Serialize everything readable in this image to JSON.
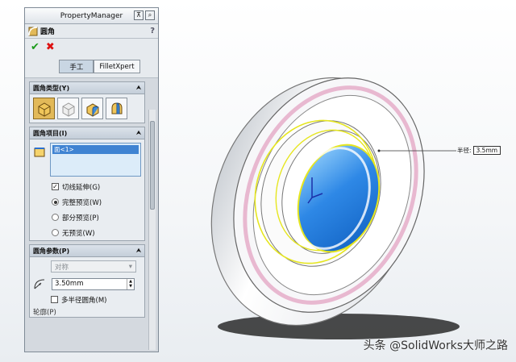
{
  "property_manager": {
    "title": "PropertyManager",
    "feature_name": "圆角",
    "help": "?",
    "tabs": [
      "手工",
      "FilletXpert"
    ],
    "fillet_type": {
      "label": "圆角类型(Y)",
      "buttons": [
        "constant-size-fillet",
        "variable-size-fillet",
        "face-fillet",
        "full-round-fillet"
      ],
      "selected_index": 0
    },
    "fillet_items": {
      "label": "圆角项目(I)",
      "list": [
        "面<1>"
      ],
      "options": [
        {
          "kind": "checkbox",
          "label": "切线延伸(G)",
          "checked": true
        },
        {
          "kind": "radio",
          "label": "完整预览(W)",
          "checked": true
        },
        {
          "kind": "radio",
          "label": "部分预览(P)",
          "checked": false
        },
        {
          "kind": "radio",
          "label": "无预览(W)",
          "checked": false
        }
      ]
    },
    "fillet_params": {
      "label": "圆角参数(P)",
      "method": "对称",
      "radius": "3.50mm",
      "multi_radius_label": "多半径圆角(M)",
      "multi_radius_checked": false,
      "next_label": "轮廓(P)"
    }
  },
  "viewport": {
    "callout_label": "半径:",
    "callout_value": "3.5mm",
    "watermark": "头条 @SolidWorks大师之路"
  },
  "colors": {
    "ring_face": "#f8f8fa",
    "ring_edge": "#e8b8d0",
    "inner_face": "#2e88e6",
    "selection": "#e6e61f"
  }
}
